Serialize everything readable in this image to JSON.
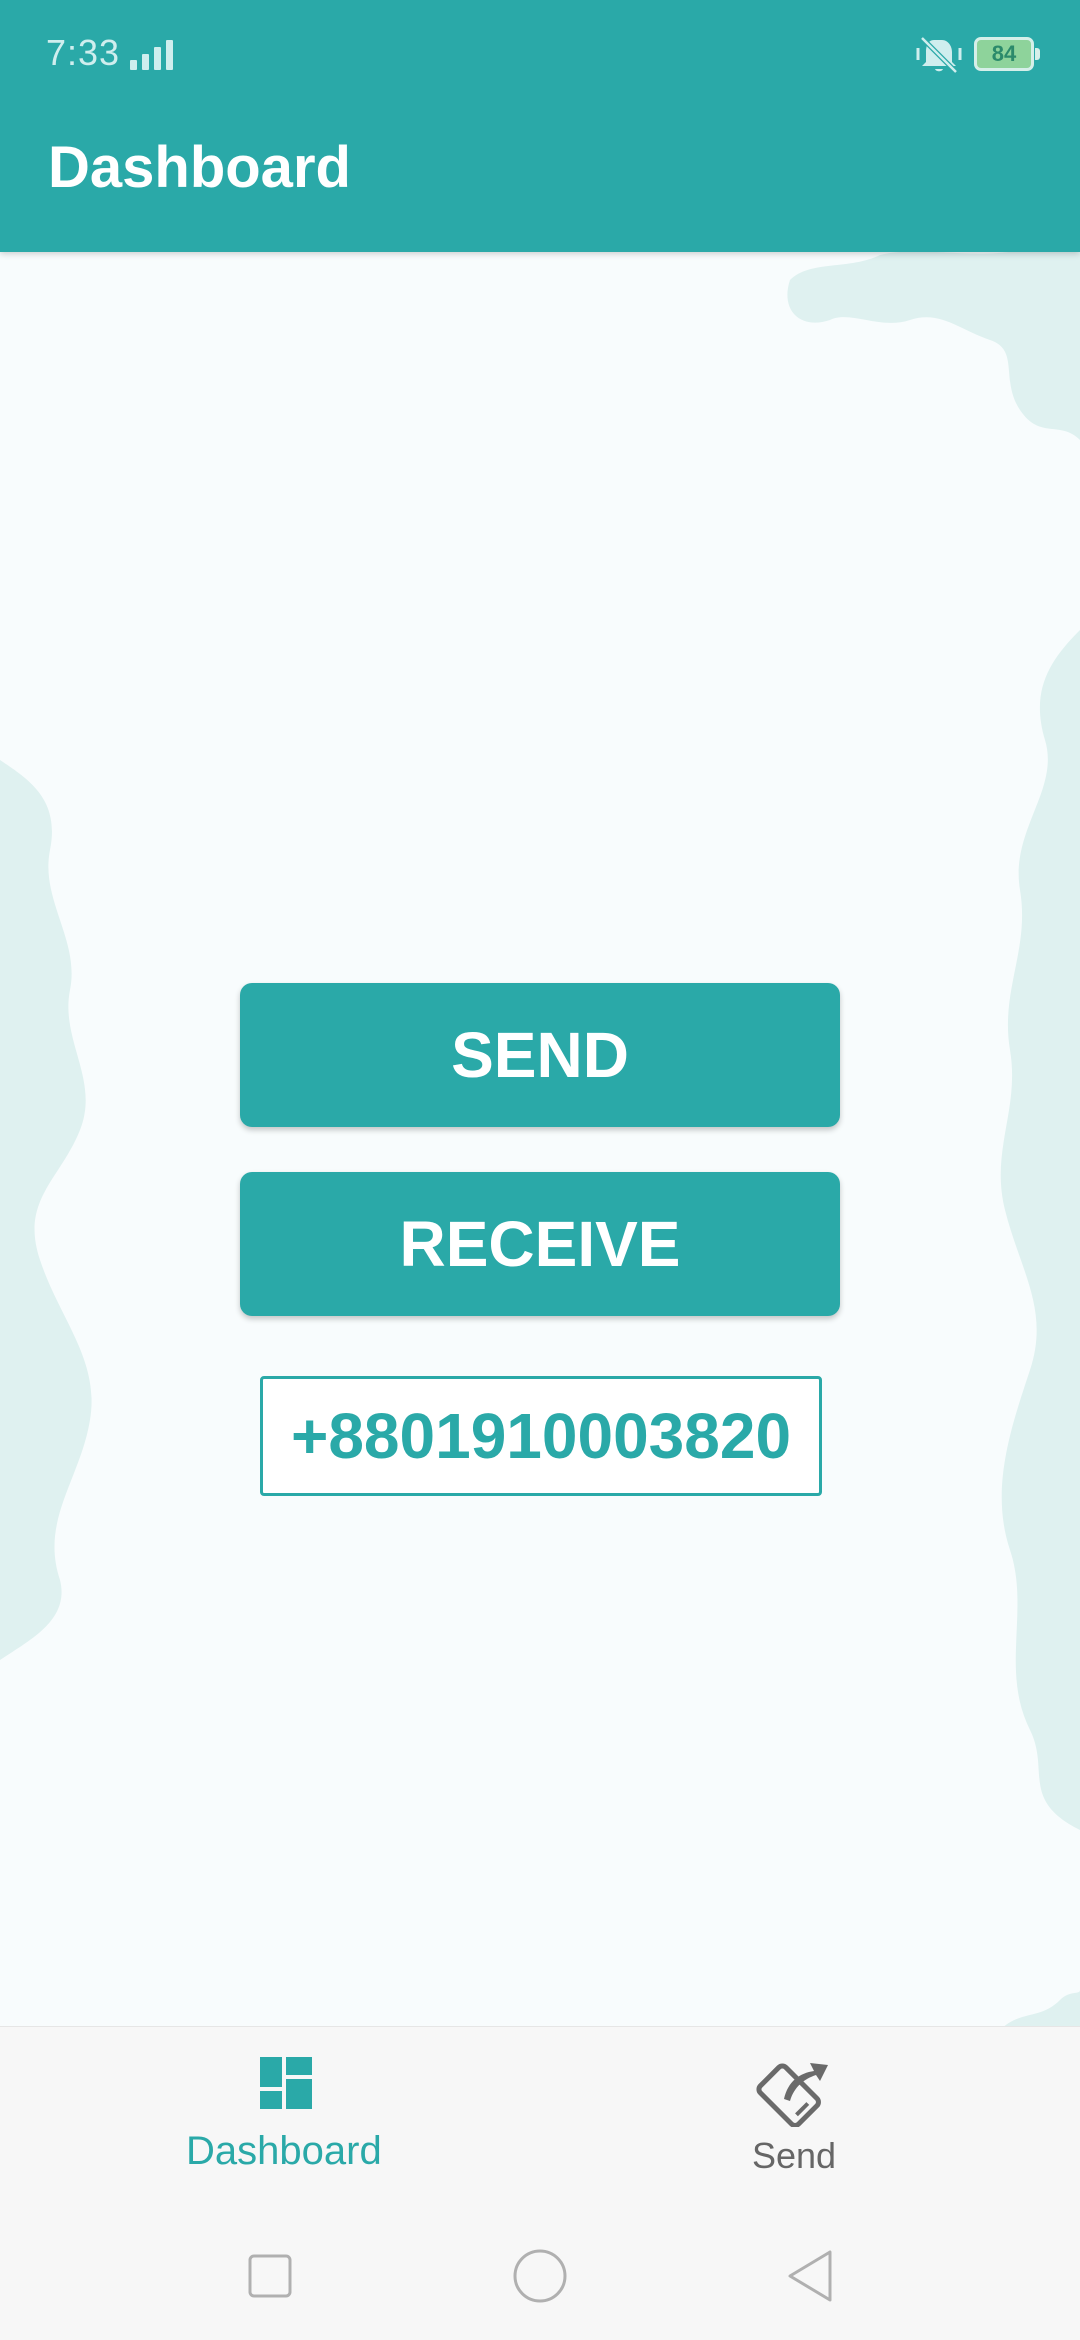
{
  "status_bar": {
    "time": "7:33",
    "battery_level": "84"
  },
  "app_bar": {
    "title": "Dashboard"
  },
  "main": {
    "send_label": "SEND",
    "receive_label": "RECEIVE",
    "phone_number": "+8801910003820"
  },
  "bottom_nav": {
    "items": [
      {
        "label": "Dashboard",
        "icon": "dashboard-icon",
        "active": true
      },
      {
        "label": "Send",
        "icon": "send-phone-icon",
        "active": false
      }
    ]
  },
  "colors": {
    "primary": "#2aa9a8",
    "background": "#f8fcfd",
    "splash": "#dff1f0",
    "inactive": "#666666"
  }
}
